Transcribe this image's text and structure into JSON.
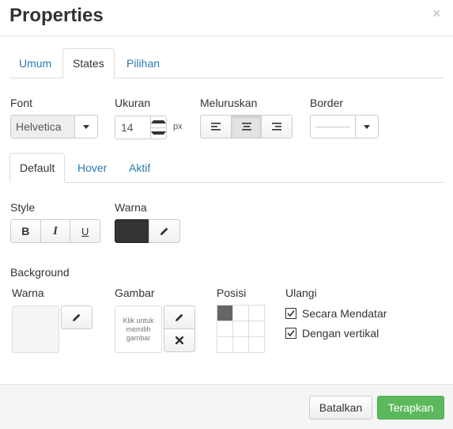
{
  "dialog": {
    "title": "Properties",
    "close": "×"
  },
  "tabs": [
    {
      "label": "Umum",
      "active": false
    },
    {
      "label": "States",
      "active": true
    },
    {
      "label": "Pilihan",
      "active": false
    }
  ],
  "font": {
    "label": "Font",
    "value": "Helvetica"
  },
  "size": {
    "label": "Ukuran",
    "value": "14",
    "unit": "px"
  },
  "align": {
    "label": "Meluruskan",
    "options": [
      "left-align-icon",
      "center-align-icon",
      "right-align-icon"
    ],
    "selected": "center"
  },
  "border": {
    "label": "Border"
  },
  "state_tabs": [
    {
      "label": "Default",
      "active": true
    },
    {
      "label": "Hover",
      "active": false
    },
    {
      "label": "Aktif",
      "active": false
    }
  ],
  "style": {
    "label": "Style",
    "bold": "B",
    "italic": "I",
    "underline": "U"
  },
  "color": {
    "label": "Warna",
    "value": "#333333"
  },
  "background": {
    "label": "Background",
    "color_label": "Warna",
    "color_value": "#f5f5f5",
    "image_label": "Gambar",
    "image_placeholder": "Klik untuk memilih gambar",
    "position_label": "Posisi",
    "position_selected": "top-left",
    "repeat_label": "Ulangi",
    "repeat_horizontal": {
      "label": "Secara Mendatar",
      "checked": true
    },
    "repeat_vertical": {
      "label": "Dengan vertikal",
      "checked": true
    }
  },
  "footer": {
    "cancel": "Batalkan",
    "apply": "Terapkan"
  },
  "colors": {
    "link": "#2a7ab0",
    "apply_bg": "#5cb85c"
  }
}
